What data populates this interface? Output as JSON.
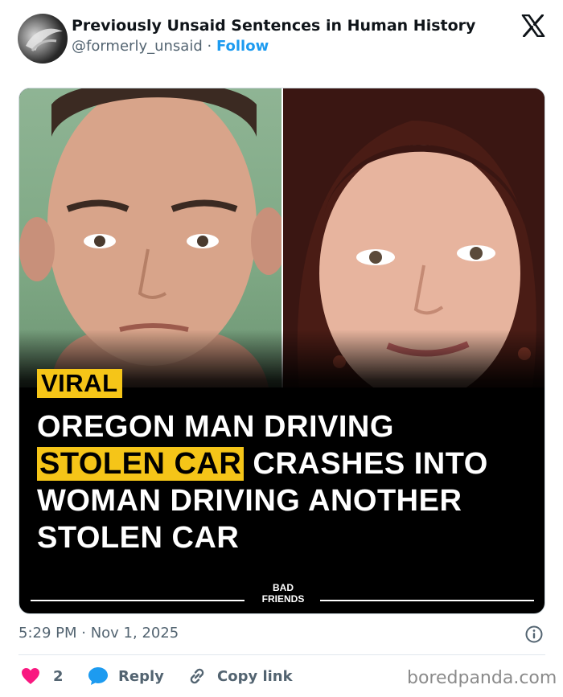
{
  "author": {
    "display_name": "Previously Unsaid Sentences in Human History",
    "handle": "@formerly_unsaid",
    "separator": "·",
    "follow_label": "Follow"
  },
  "media": {
    "tag": "VIRAL",
    "headline_line1": "OREGON MAN DRIVING",
    "headline_highlight": "STOLEN CAR",
    "headline_line2_rest": " CRASHES INTO",
    "headline_line3": "WOMAN DRIVING ANOTHER",
    "headline_line4": "STOLEN CAR",
    "brand_line1": "BAD",
    "brand_line2": "FRIENDS",
    "highlight_color": "#f5c518"
  },
  "tweet": {
    "timestamp": "5:29 PM · Nov 1, 2025"
  },
  "actions": {
    "like_count": "2",
    "reply_label": "Reply",
    "copy_label": "Copy link"
  },
  "watermark": "boredpanda.com",
  "icons": {
    "platform": "x-logo-icon",
    "info": "info-icon",
    "like": "heart-icon",
    "reply": "speech-bubble-icon",
    "copy": "link-icon"
  },
  "colors": {
    "like": "#f91880",
    "reply": "#1d9bf0",
    "link": "#1d9bf0",
    "muted": "#536471"
  }
}
